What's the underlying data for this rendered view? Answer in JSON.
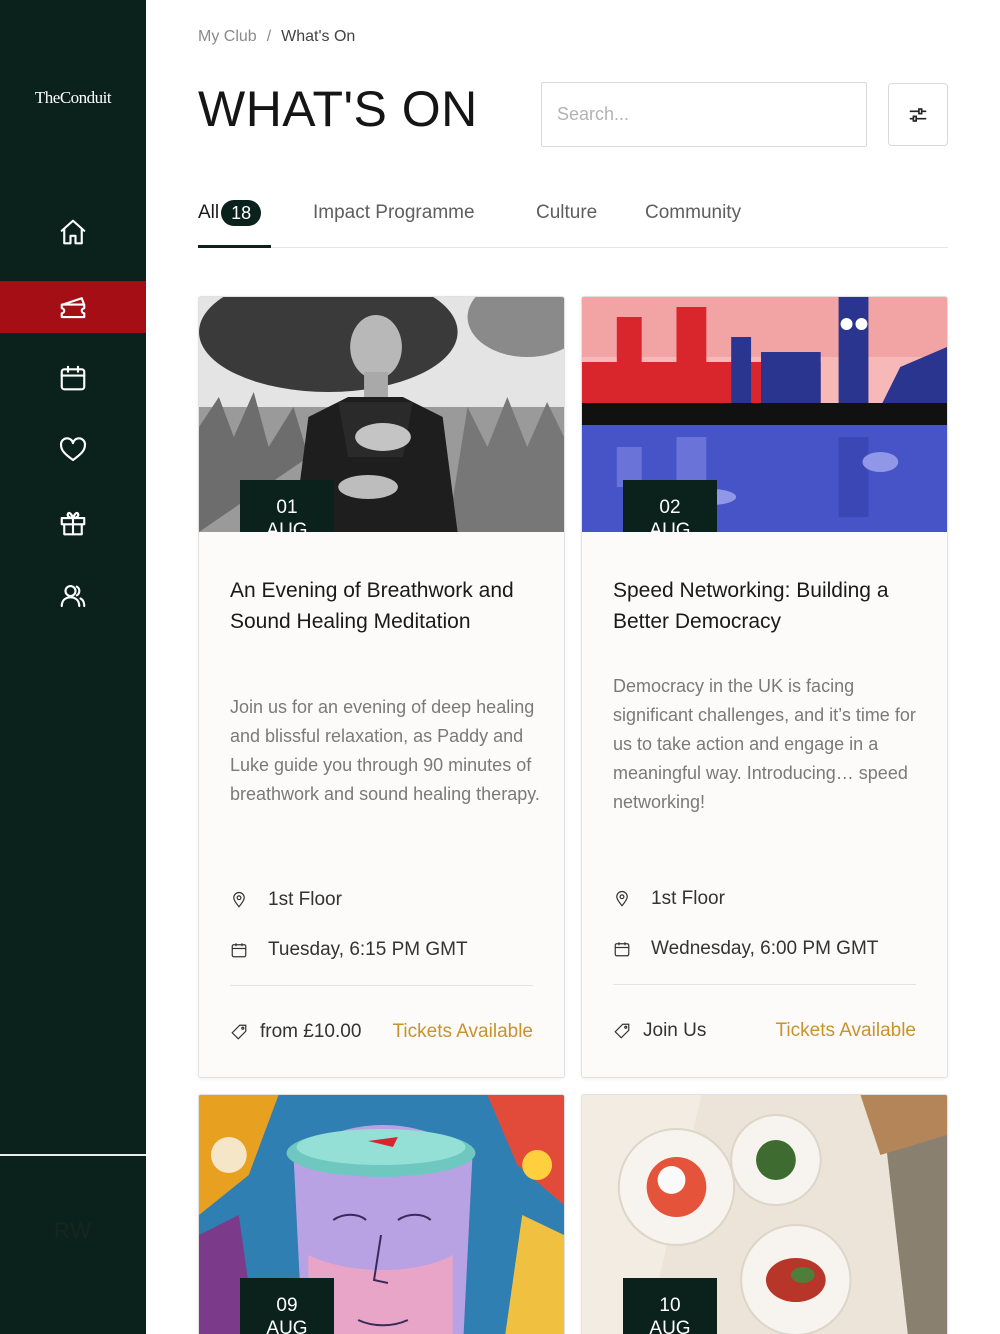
{
  "sidebar": {
    "logo": "TheConduit",
    "nav": [
      {
        "icon": "home-icon"
      },
      {
        "icon": "ticket-icon",
        "active": true
      },
      {
        "icon": "calendar-icon"
      },
      {
        "icon": "heart-icon"
      },
      {
        "icon": "gift-icon"
      },
      {
        "icon": "members-icon"
      }
    ],
    "user_initials": "RW"
  },
  "breadcrumb": {
    "parent": "My Club",
    "separator": "/",
    "current": "What's On"
  },
  "page_title": "WHAT'S ON",
  "search": {
    "placeholder": "Search...",
    "value": ""
  },
  "tabs": [
    {
      "label": "All",
      "count": "18",
      "active": true
    },
    {
      "label": "Impact Programme"
    },
    {
      "label": "Culture"
    },
    {
      "label": "Community"
    }
  ],
  "events": [
    {
      "day": "01",
      "month": "AUG",
      "title": "An Evening of Breathwork and Sound Healing Meditation",
      "description": "Join us for an evening of deep healing and blissful relaxation, as Paddy and Luke guide you through 90 minutes of breathwork and sound healing therapy.",
      "location": "1st Floor",
      "time": "Tuesday, 6:15 PM GMT",
      "price": "from £10.00",
      "availability": "Tickets Available"
    },
    {
      "day": "02",
      "month": "AUG",
      "title": "Speed Networking: Building a Better Democracy",
      "description": "Democracy in the UK is facing significant challenges, and it’s time for us to take action and engage in a meaningful way. Introducing… speed networking!",
      "location": "1st Floor",
      "time": "Wednesday, 6:00 PM GMT",
      "price": "Join Us",
      "availability": "Tickets Available"
    },
    {
      "day": "09",
      "month": "AUG"
    },
    {
      "day": "10",
      "month": "AUG"
    }
  ],
  "colors": {
    "sidebar_bg": "#0b211b",
    "active_nav": "#a40e14",
    "accent_gold": "#c8922c"
  }
}
